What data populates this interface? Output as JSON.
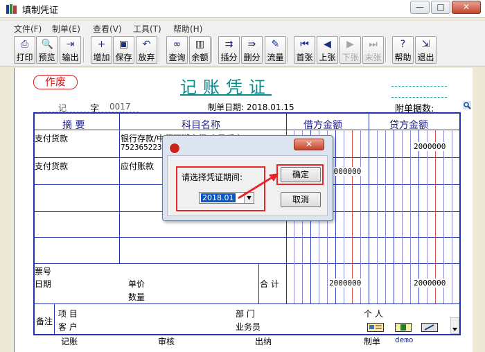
{
  "window": {
    "title": "填制凭证",
    "minimize_glyph": "—",
    "maximize_glyph": "□",
    "close_glyph": "✕"
  },
  "menu": [
    "文件(F)",
    "制单(E)",
    "查看(V)",
    "工具(T)",
    "帮助(H)"
  ],
  "toolbar": [
    {
      "label": "打印",
      "icon": "printer-icon",
      "glyph": "⎙",
      "enabled": true
    },
    {
      "label": "预览",
      "icon": "preview-icon",
      "glyph": "🔍",
      "enabled": true
    },
    {
      "label": "输出",
      "icon": "export-icon",
      "glyph": "⇥",
      "enabled": true
    },
    {
      "label": "增加",
      "icon": "add-icon",
      "glyph": "+",
      "enabled": true
    },
    {
      "label": "保存",
      "icon": "save-icon",
      "glyph": "▣",
      "enabled": true
    },
    {
      "label": "放弃",
      "icon": "undo-icon",
      "glyph": "↶",
      "enabled": true
    },
    {
      "label": "查询",
      "icon": "binoculars-icon",
      "glyph": "∞",
      "enabled": true
    },
    {
      "label": "余额",
      "icon": "bar-chart-icon",
      "glyph": "▥",
      "enabled": true
    },
    {
      "label": "插分",
      "icon": "insert-row-icon",
      "glyph": "⇉",
      "enabled": true
    },
    {
      "label": "删分",
      "icon": "delete-row-icon",
      "glyph": "⇛",
      "enabled": true
    },
    {
      "label": "流量",
      "icon": "pencil-icon",
      "glyph": "✎",
      "enabled": true
    },
    {
      "label": "首张",
      "icon": "first-record-icon",
      "glyph": "⏮",
      "enabled": true
    },
    {
      "label": "上张",
      "icon": "previous-record-icon",
      "glyph": "◀",
      "enabled": true
    },
    {
      "label": "下张",
      "icon": "next-record-icon",
      "glyph": "▶",
      "enabled": false
    },
    {
      "label": "末张",
      "icon": "last-record-icon",
      "glyph": "⏭",
      "enabled": false
    },
    {
      "label": "帮助",
      "icon": "help-icon",
      "glyph": "?",
      "enabled": true
    },
    {
      "label": "退出",
      "icon": "exit-icon",
      "glyph": "⇲",
      "enabled": true
    }
  ],
  "voucher": {
    "void_badge": "作废",
    "title": "记账凭证",
    "type_char": "记",
    "zi_label": "字",
    "number": "0017",
    "date_label": "制单日期:",
    "date": "2018.01.15",
    "attach_label": "附单据数:",
    "headers": {
      "summary": "摘 要",
      "account": "科目名称",
      "debit": "借方金额",
      "credit": "贷方金额"
    },
    "rows": [
      {
        "summary": "支付货款",
        "account": "银行存款/中行西湖支行/人民币户",
        "account_sub": "7523652230",
        "debit": "",
        "credit": "2000000"
      },
      {
        "summary": "支付货款",
        "account": "应付账款",
        "account_sub": "",
        "debit": "2000000",
        "credit": ""
      }
    ],
    "footer": {
      "ticket_no_label": "票号",
      "date_label": "日期",
      "unit_price_label": "单价",
      "quantity_label": "数量",
      "total_label": "合 计",
      "total_debit": "2000000",
      "total_credit": "2000000",
      "note_label": "备注",
      "project_label": "项 目",
      "customer_label": "客 户",
      "dept_label": "部 门",
      "salesman_label": "业务员",
      "person_label": "个 人"
    },
    "signatures": {
      "bookkeeper": "记账",
      "auditor": "审核",
      "cashier": "出纳",
      "maker": "制单",
      "maker_name": "demo"
    }
  },
  "dialog": {
    "prompt": "请选择凭证期间:",
    "period_value": "2018.01",
    "ok_label": "确定",
    "cancel_label": "取消",
    "close_glyph": "✕"
  },
  "colors": {
    "accent_teal": "#0a8a8a",
    "table_blue": "#2233aa",
    "highlight_red": "#e8262a",
    "void_red": "#d21e1e"
  }
}
